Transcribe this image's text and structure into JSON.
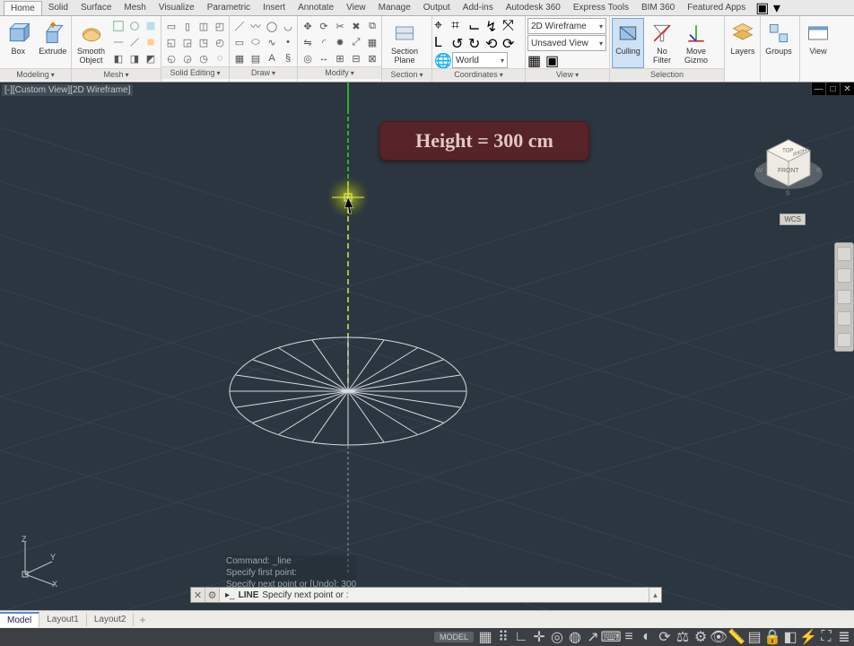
{
  "ribbon": {
    "tabs": [
      "Home",
      "Solid",
      "Surface",
      "Mesh",
      "Visualize",
      "Parametric",
      "Insert",
      "Annotate",
      "View",
      "Manage",
      "Output",
      "Add-ins",
      "Autodesk 360",
      "Express Tools",
      "BIM 360",
      "Featured Apps"
    ],
    "active_tab": 0,
    "tail": "▣ ▾"
  },
  "panels": {
    "modeling": {
      "title": "Modeling",
      "items": [
        {
          "label": "Box"
        },
        {
          "label": "Extrude"
        }
      ]
    },
    "mesh": {
      "title": "Mesh",
      "items": [
        {
          "label": "Smooth\nObject"
        }
      ]
    },
    "solid_editing": {
      "title": "Solid Editing"
    },
    "draw": {
      "title": "Draw"
    },
    "modify": {
      "title": "Modify"
    },
    "section": {
      "title": "Section",
      "items": [
        {
          "label": "Section\nPlane"
        }
      ]
    },
    "coordinates": {
      "title": "Coordinates",
      "world": "World"
    },
    "view": {
      "title": "View",
      "visual_style": "2D Wireframe",
      "saved_view": "Unsaved View"
    },
    "selection": {
      "title": "Selection",
      "items": [
        {
          "label": "Culling"
        },
        {
          "label": "No\nFilter"
        },
        {
          "label": "Move\nGizmo"
        }
      ]
    },
    "layers": {
      "title": "",
      "items": [
        {
          "label": "Layers"
        }
      ]
    },
    "groups": {
      "title": "",
      "items": [
        {
          "label": "Groups"
        }
      ]
    },
    "viewpanel": {
      "title": "",
      "items": [
        {
          "label": "View"
        }
      ]
    }
  },
  "document": {
    "view_title": "[-][Custom View][2D Wireframe]"
  },
  "annotation": {
    "height_label": "Height = 300 cm"
  },
  "viewcube": {
    "front": "FRONT",
    "right": "RIGHT",
    "top": "TOP",
    "w": "W",
    "s": "S",
    "e": "E",
    "wcs": "WCS"
  },
  "ucs": {
    "x": "X",
    "y": "Y",
    "z": "Z"
  },
  "command": {
    "history": [
      "Command: _line",
      "Specify first point:",
      "Specify next point or [Undo]: 300"
    ],
    "prompt_keyword": "LINE",
    "prompt_text": "Specify next point or :"
  },
  "layout_tabs": {
    "tabs": [
      "Model",
      "Layout1",
      "Layout2"
    ],
    "active": 0
  },
  "status": {
    "model_btn": "MODEL"
  }
}
